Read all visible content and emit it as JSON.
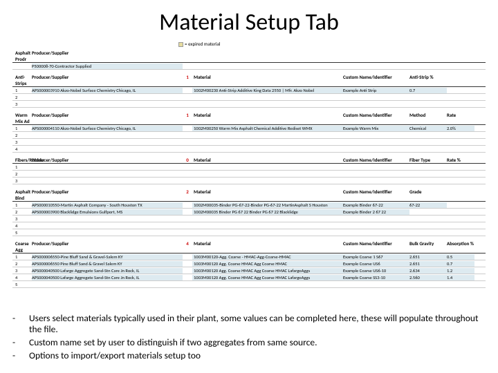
{
  "title": "Material Setup Tab",
  "legend": "= expired material",
  "sections": [
    {
      "name": "Asphalt Prodr",
      "ps_header": "Producer/Supplier",
      "count": "",
      "mat_header": "",
      "cust_header": "",
      "col_a": "",
      "col_b": "",
      "top_row": {
        "ps": "P500008-70-Contractor Supplied",
        "mat": "",
        "cust": "",
        "a": "",
        "b": ""
      },
      "rows": []
    },
    {
      "name": "Anti-Strips",
      "ps_header": "Producer/Supplier",
      "count": "1",
      "mat_header": "Material",
      "cust_header": "Custom Name/Identifier",
      "col_a": "Anti-Strip %",
      "col_b": "",
      "rows": [
        {
          "idx": "1",
          "ps": "APS000003910 Akzo-Nobel Surface Chemistry   Chicago, IL",
          "mat": "1002M00230 Anti-Strip Additive King Data 2550 | Mfr. Akzo Nobel",
          "cust": "Example Anti Strip",
          "a": "0.7",
          "b": ""
        },
        {
          "idx": "2",
          "ps": "",
          "mat": "",
          "cust": "",
          "a": "",
          "b": ""
        },
        {
          "idx": "3",
          "ps": "",
          "mat": "",
          "cust": "",
          "a": "",
          "b": ""
        }
      ]
    },
    {
      "name": "Warm Mix Ad",
      "ps_header": "Producer/Supplier",
      "count": "1",
      "mat_header": "Material",
      "cust_header": "Custom Name/Identifier",
      "col_a": "Method",
      "col_b": "Rate",
      "rows": [
        {
          "idx": "1",
          "ps": "APS000004110 Akzo-Nobel Surface Chemistry   Chicago, IL",
          "mat": "1002M00250 Warm Mix Asphalt Chemical Additive Rediset WMX",
          "cust": "Example Warm Mix",
          "a": "Chemical",
          "b": "2.0%"
        },
        {
          "idx": "2",
          "ps": "",
          "mat": "",
          "cust": "",
          "a": "",
          "b": ""
        },
        {
          "idx": "3",
          "ps": "",
          "mat": "",
          "cust": "",
          "a": "",
          "b": ""
        },
        {
          "idx": "4",
          "ps": "",
          "mat": "",
          "cust": "",
          "a": "",
          "b": ""
        }
      ]
    },
    {
      "name": "Fibers/Rubber",
      "ps_header": "Producer/Supplier",
      "count": "0",
      "mat_header": "Material",
      "cust_header": "Custom Name/Identifier",
      "col_a": "Fiber Type",
      "col_b": "Rate %",
      "rows": [
        {
          "idx": "1",
          "ps": "",
          "mat": "",
          "cust": "",
          "a": "",
          "b": ""
        },
        {
          "idx": "2",
          "ps": "",
          "mat": "",
          "cust": "",
          "a": "",
          "b": ""
        },
        {
          "idx": "3",
          "ps": "",
          "mat": "",
          "cust": "",
          "a": "",
          "b": ""
        }
      ]
    },
    {
      "name": "Asphalt Bind",
      "ps_header": "Producer/Supplier",
      "count": "2",
      "mat_header": "Material",
      "cust_header": "Custom Name/Identifier",
      "col_a": "Grade",
      "col_b": "",
      "rows": [
        {
          "idx": "1",
          "ps": "APS000010550-Martin Asphalt Company - South Houston TX",
          "mat": "1002M00035-Binder PG-67-22-Binder PG-67-22 MartinAsphalt S Houston",
          "cust": "Example Binder 67-22",
          "a": "67-22",
          "b": ""
        },
        {
          "idx": "2",
          "ps": "APS000003900 Blacklidge Emulsions    Gulfport, MS",
          "mat": "1002M00035 Binder PG 67 22 Binder PG 67 22 Blacklidge",
          "cust": "Example Binder 2 67 22",
          "a": "",
          "b": ""
        },
        {
          "idx": "3",
          "ps": "",
          "mat": "",
          "cust": "",
          "a": "",
          "b": ""
        },
        {
          "idx": "4",
          "ps": "",
          "mat": "",
          "cust": "",
          "a": "",
          "b": ""
        },
        {
          "idx": "5",
          "ps": "",
          "mat": "",
          "cust": "",
          "a": "",
          "b": ""
        }
      ]
    },
    {
      "name": "Coarse Agg",
      "ps_header": "Producer/Supplier",
      "count": "4",
      "mat_header": "Material",
      "cust_header": "Custom Name/Identifier",
      "col_a": "Bulk Gravity",
      "col_b": "Absorption %",
      "rows": [
        {
          "idx": "1",
          "ps": "APS000006550-Pine Bluff Sand & Gravel-Salem KY",
          "mat": "1003M00120-Agg. Coarse - HMAC-Agg-Coarse-HMAC",
          "cust": "Example Coarse 1 S67",
          "a": "2.651",
          "b": "0.5"
        },
        {
          "idx": "2",
          "ps": "APS000006550 Pine Bluff Sand & Gravel Salem KY",
          "mat": "1003M00120 Agg. Coarse   HMAC Agg Coarse HMAC",
          "cust": "Example Coarse US6",
          "a": "2.651",
          "b": "0.7"
        },
        {
          "idx": "3",
          "ps": "APS000040500 Lafarge Aggregate Sand-Stn Care Jn Rock, IL",
          "mat": "1003M00120 Agg. Coarse   HMAC Agg Coarse HMAC LafargeAggs",
          "cust": "Example Coarse US6-10",
          "a": "2.634",
          "b": "1.2"
        },
        {
          "idx": "4",
          "ps": "APS000040500 Lafarge Aggregate Sand-Stn Care Jn Rock, IL",
          "mat": "1003M00120 Agg. Coarse   HMAC Agg Coarse HMAC LafargeAggs",
          "cust": "Example Coarse SS3-10",
          "a": "2.560",
          "b": "1.4"
        },
        {
          "idx": "5",
          "ps": "",
          "mat": "",
          "cust": "",
          "a": "",
          "b": ""
        }
      ]
    }
  ],
  "bullets": [
    "Users select materials typically used in their plant, some values can be completed here, these will populate throughout the file.",
    "Custom name set by user to distinguish if two aggregates from same source.",
    "Options to import/export materials setup too"
  ]
}
